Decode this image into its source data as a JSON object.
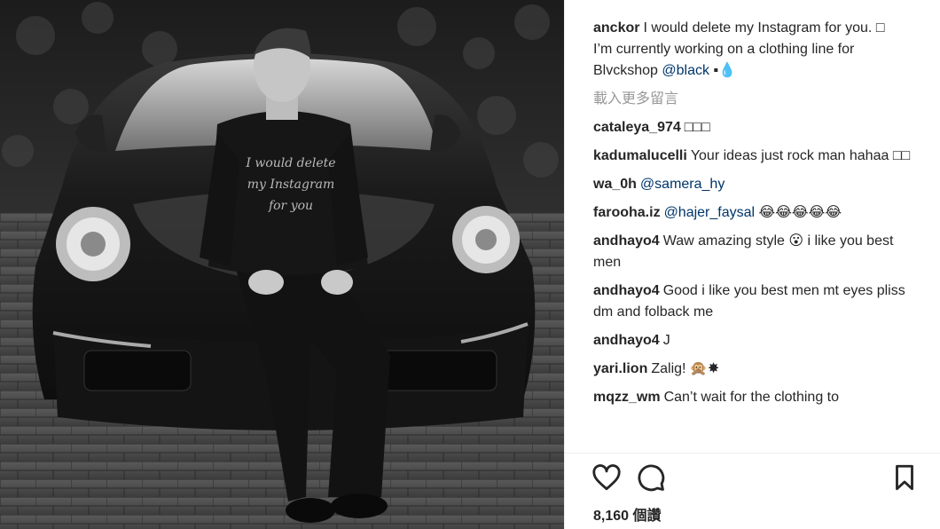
{
  "post": {
    "caption": {
      "username": "anckor",
      "line1": "I would delete my Instagram for you. □",
      "line2_text": "I’m currently working on a clothing line for Blvckshop",
      "line2_mention": "@black",
      "line2_emoji": "▪💧"
    },
    "load_more": "載入更多留言",
    "comments": [
      {
        "username": "cataleya_974",
        "text": "□□□",
        "mention": ""
      },
      {
        "username": "kadumalucelli",
        "text": "Your ideas just rock man hahaa □□",
        "mention": ""
      },
      {
        "username": "wa_0h",
        "text": "",
        "mention": "@samera_hy"
      },
      {
        "username": "farooha.iz",
        "text": "😂😂😂😂😂",
        "mention": "@hajer_faysal"
      },
      {
        "username": "andhayo4",
        "text": "Waw amazing style 😮 i like you best men",
        "mention": ""
      },
      {
        "username": "andhayo4",
        "text": "Good i like you best men mt eyes pliss dm and folback me",
        "mention": ""
      },
      {
        "username": "andhayo4",
        "text": "J",
        "mention": ""
      },
      {
        "username": "yari.lion",
        "text": "Zalig! 🙊✸",
        "mention": ""
      },
      {
        "username": "mqzz_wm",
        "text": "Can’t wait for the clothing to",
        "mention": ""
      }
    ],
    "likes": "8,160 個讚",
    "shirt_text": [
      "I would delete",
      "my Instagram",
      "for you"
    ],
    "icons": {
      "like": "heart-icon",
      "comment": "comment-bubble-icon",
      "save": "bookmark-icon"
    },
    "colors": {
      "mention": "#003569",
      "muted": "#999999",
      "text": "#262626"
    }
  }
}
